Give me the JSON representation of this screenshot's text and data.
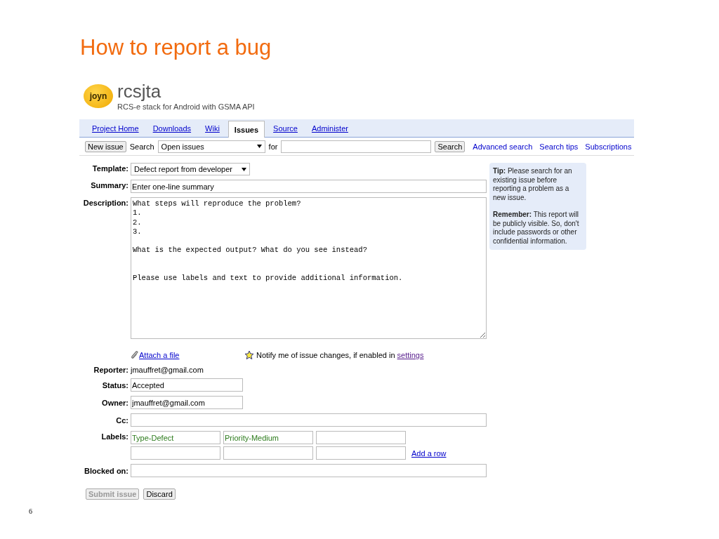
{
  "slide": {
    "title": "How to report a bug",
    "page_number": "6"
  },
  "project": {
    "logo_text": "joyn",
    "name": "rcsjta",
    "summary": "RCS-e stack for Android with GSMA API"
  },
  "tabs": [
    {
      "label": "Project Home",
      "selected": false
    },
    {
      "label": "Downloads",
      "selected": false
    },
    {
      "label": "Wiki",
      "selected": false
    },
    {
      "label": "Issues",
      "selected": true
    },
    {
      "label": "Source",
      "selected": false
    },
    {
      "label": "Administer",
      "selected": false
    }
  ],
  "search_bar": {
    "new_issue_button": "New issue",
    "search_label": "Search",
    "scope": "Open issues",
    "for_label": "for",
    "search_button": "Search",
    "links": [
      "Advanced search",
      "Search tips",
      "Subscriptions"
    ]
  },
  "form": {
    "template": {
      "label": "Template:",
      "value": "Defect report from developer"
    },
    "summary": {
      "label": "Summary:",
      "value": "Enter one-line summary"
    },
    "description": {
      "label": "Description:",
      "value": "What steps will reproduce the problem?\n1. \n2. \n3. \n\nWhat is the expected output? What do you see instead?\n\n\nPlease use labels and text to provide additional information."
    },
    "attach_link": "Attach a file",
    "notify": {
      "text": "Notify me of issue changes, if enabled in",
      "link": "settings"
    },
    "reporter": {
      "label": "Reporter:",
      "value": "jmauffret@gmail.com"
    },
    "status": {
      "label": "Status:",
      "value": "Accepted"
    },
    "owner": {
      "label": "Owner:",
      "value": "jmauffret@gmail.com"
    },
    "cc": {
      "label": "Cc:"
    },
    "labels": {
      "label": "Labels:",
      "values": [
        "Type-Defect",
        "Priority-Medium"
      ],
      "add_row_link": "Add a row"
    },
    "blocked_on": {
      "label": "Blocked on:"
    },
    "buttons": [
      {
        "label": "Submit issue",
        "disabled": true
      },
      {
        "label": "Discard",
        "disabled": false
      }
    ]
  },
  "tip_box": {
    "tip": "**Tip:** Please search for an existing issue before reporting a problem as a new issue.",
    "remember": "**Remember:** This report will be publicly visible. So, don't include passwords or other confidential information."
  }
}
